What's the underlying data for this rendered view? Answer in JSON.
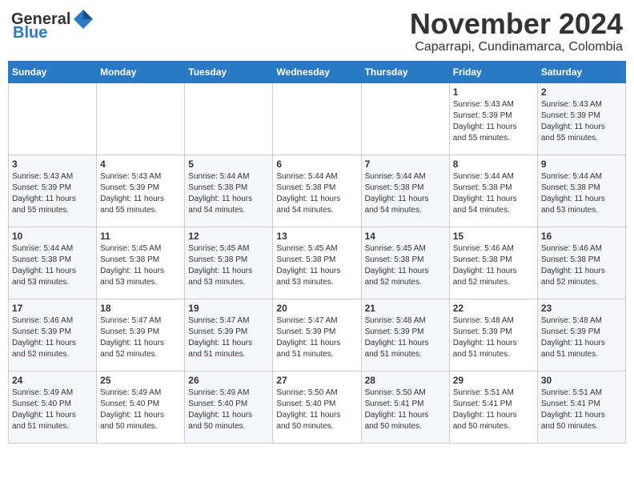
{
  "header": {
    "logo_general": "General",
    "logo_blue": "Blue",
    "month_title": "November 2024",
    "location": "Caparrapi, Cundinamarca, Colombia"
  },
  "columns": [
    "Sunday",
    "Monday",
    "Tuesday",
    "Wednesday",
    "Thursday",
    "Friday",
    "Saturday"
  ],
  "weeks": [
    [
      {
        "day": "",
        "info": ""
      },
      {
        "day": "",
        "info": ""
      },
      {
        "day": "",
        "info": ""
      },
      {
        "day": "",
        "info": ""
      },
      {
        "day": "",
        "info": ""
      },
      {
        "day": "1",
        "info": "Sunrise: 5:43 AM\nSunset: 5:39 PM\nDaylight: 11 hours\nand 55 minutes."
      },
      {
        "day": "2",
        "info": "Sunrise: 5:43 AM\nSunset: 5:39 PM\nDaylight: 11 hours\nand 55 minutes."
      }
    ],
    [
      {
        "day": "3",
        "info": "Sunrise: 5:43 AM\nSunset: 5:39 PM\nDaylight: 11 hours\nand 55 minutes."
      },
      {
        "day": "4",
        "info": "Sunrise: 5:43 AM\nSunset: 5:39 PM\nDaylight: 11 hours\nand 55 minutes."
      },
      {
        "day": "5",
        "info": "Sunrise: 5:44 AM\nSunset: 5:38 PM\nDaylight: 11 hours\nand 54 minutes."
      },
      {
        "day": "6",
        "info": "Sunrise: 5:44 AM\nSunset: 5:38 PM\nDaylight: 11 hours\nand 54 minutes."
      },
      {
        "day": "7",
        "info": "Sunrise: 5:44 AM\nSunset: 5:38 PM\nDaylight: 11 hours\nand 54 minutes."
      },
      {
        "day": "8",
        "info": "Sunrise: 5:44 AM\nSunset: 5:38 PM\nDaylight: 11 hours\nand 54 minutes."
      },
      {
        "day": "9",
        "info": "Sunrise: 5:44 AM\nSunset: 5:38 PM\nDaylight: 11 hours\nand 53 minutes."
      }
    ],
    [
      {
        "day": "10",
        "info": "Sunrise: 5:44 AM\nSunset: 5:38 PM\nDaylight: 11 hours\nand 53 minutes."
      },
      {
        "day": "11",
        "info": "Sunrise: 5:45 AM\nSunset: 5:38 PM\nDaylight: 11 hours\nand 53 minutes."
      },
      {
        "day": "12",
        "info": "Sunrise: 5:45 AM\nSunset: 5:38 PM\nDaylight: 11 hours\nand 53 minutes."
      },
      {
        "day": "13",
        "info": "Sunrise: 5:45 AM\nSunset: 5:38 PM\nDaylight: 11 hours\nand 53 minutes."
      },
      {
        "day": "14",
        "info": "Sunrise: 5:45 AM\nSunset: 5:38 PM\nDaylight: 11 hours\nand 52 minutes."
      },
      {
        "day": "15",
        "info": "Sunrise: 5:46 AM\nSunset: 5:38 PM\nDaylight: 11 hours\nand 52 minutes."
      },
      {
        "day": "16",
        "info": "Sunrise: 5:46 AM\nSunset: 5:38 PM\nDaylight: 11 hours\nand 52 minutes."
      }
    ],
    [
      {
        "day": "17",
        "info": "Sunrise: 5:46 AM\nSunset: 5:39 PM\nDaylight: 11 hours\nand 52 minutes."
      },
      {
        "day": "18",
        "info": "Sunrise: 5:47 AM\nSunset: 5:39 PM\nDaylight: 11 hours\nand 52 minutes."
      },
      {
        "day": "19",
        "info": "Sunrise: 5:47 AM\nSunset: 5:39 PM\nDaylight: 11 hours\nand 51 minutes."
      },
      {
        "day": "20",
        "info": "Sunrise: 5:47 AM\nSunset: 5:39 PM\nDaylight: 11 hours\nand 51 minutes."
      },
      {
        "day": "21",
        "info": "Sunrise: 5:48 AM\nSunset: 5:39 PM\nDaylight: 11 hours\nand 51 minutes."
      },
      {
        "day": "22",
        "info": "Sunrise: 5:48 AM\nSunset: 5:39 PM\nDaylight: 11 hours\nand 51 minutes."
      },
      {
        "day": "23",
        "info": "Sunrise: 5:48 AM\nSunset: 5:39 PM\nDaylight: 11 hours\nand 51 minutes."
      }
    ],
    [
      {
        "day": "24",
        "info": "Sunrise: 5:49 AM\nSunset: 5:40 PM\nDaylight: 11 hours\nand 51 minutes."
      },
      {
        "day": "25",
        "info": "Sunrise: 5:49 AM\nSunset: 5:40 PM\nDaylight: 11 hours\nand 50 minutes."
      },
      {
        "day": "26",
        "info": "Sunrise: 5:49 AM\nSunset: 5:40 PM\nDaylight: 11 hours\nand 50 minutes."
      },
      {
        "day": "27",
        "info": "Sunrise: 5:50 AM\nSunset: 5:40 PM\nDaylight: 11 hours\nand 50 minutes."
      },
      {
        "day": "28",
        "info": "Sunrise: 5:50 AM\nSunset: 5:41 PM\nDaylight: 11 hours\nand 50 minutes."
      },
      {
        "day": "29",
        "info": "Sunrise: 5:51 AM\nSunset: 5:41 PM\nDaylight: 11 hours\nand 50 minutes."
      },
      {
        "day": "30",
        "info": "Sunrise: 5:51 AM\nSunset: 5:41 PM\nDaylight: 11 hours\nand 50 minutes."
      }
    ]
  ]
}
